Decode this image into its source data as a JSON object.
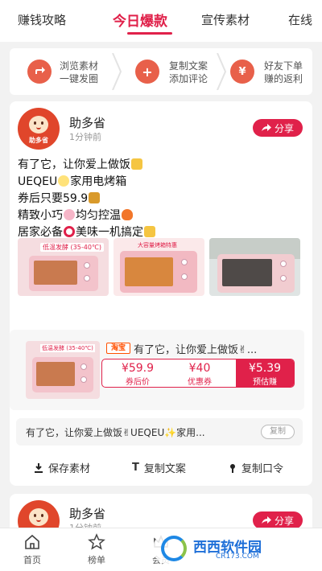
{
  "tabs": [
    {
      "label": "赚钱攻略"
    },
    {
      "label": "今日爆款"
    },
    {
      "label": "宣传素材"
    },
    {
      "label": "在线"
    }
  ],
  "steps": [
    {
      "icon": "share-icon",
      "line1": "浏览素材",
      "line2": "一键发圈"
    },
    {
      "icon": "plus-icon",
      "line1": "复制文案",
      "line2": "添加评论"
    },
    {
      "icon": "yen-icon",
      "line1": "好友下单",
      "line2": "赚的返利"
    }
  ],
  "post": {
    "author": "助多省",
    "avatar_label": "助多省",
    "time": "1分钟前",
    "share_label": "分享",
    "lines": [
      "有了它，让你爱上做饭",
      "UEQEU",
      "家用电烤箱",
      "券后只要59.9",
      "精致小巧",
      "均匀控温",
      "居家必备",
      "美味一机搞定"
    ],
    "image_captions": [
      "低温发酵 (35-40℃)",
      "大容量烤箱特惠",
      ""
    ],
    "product": {
      "platform": "淘宝",
      "title": "有了它，让你爱上做饭✌...",
      "thumb_caption": "低温发酵 (35-40℃)",
      "coupon_price": "¥59.9",
      "coupon_price_label": "券后价",
      "coupon": "¥40",
      "coupon_label": "优惠券",
      "earn": "¥5.39",
      "earn_label": "预估赚"
    },
    "copy_text": "有了它，让你爱上做饭✌UEQEU✨家用...",
    "copy_button": "复制",
    "actions": [
      {
        "icon": "download-icon",
        "label": "保存素材"
      },
      {
        "icon": "text-icon",
        "label": "复制文案"
      },
      {
        "icon": "pin-icon",
        "label": "复制口令"
      }
    ]
  },
  "post2": {
    "author": "助多省",
    "time": "1分钟前",
    "share_label": "分享"
  },
  "bottom_nav": [
    {
      "icon": "home-icon",
      "label": "首页"
    },
    {
      "icon": "star-icon",
      "label": "榜单"
    },
    {
      "icon": "crown-icon",
      "label": "会员"
    }
  ],
  "watermark": {
    "text": "西西软件园",
    "url": "CR173.COM"
  },
  "colors": {
    "accent": "#e0214a",
    "step_circle": "#e8604a",
    "taobao": "#ff5000"
  }
}
